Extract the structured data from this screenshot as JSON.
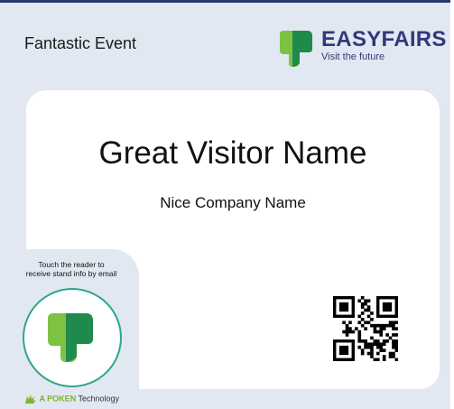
{
  "header": {
    "event_title": "Fantastic Event"
  },
  "logo": {
    "brand_name": "EASYFAIRS",
    "tagline": "Visit the future"
  },
  "card": {
    "visitor_name": "Great Visitor Name",
    "company_name": "Nice Company Name"
  },
  "reader": {
    "instruction_line1": "Touch the reader to",
    "instruction_line2": "receive stand info by email",
    "brand_prefix": "A POKEN",
    "brand_suffix": " Technology"
  },
  "icons": {
    "logo": "easyfairs-logo-icon",
    "reader": "easyfairs-reader-icon",
    "poken": "poken-hand-icon",
    "qr": "qr-code-icon"
  },
  "colors": {
    "brand_navy": "#2f3a7b",
    "green_dark": "#1f8a4c",
    "green_light": "#7ec242",
    "teal": "#2ea58f",
    "badge_bg": "#e1e8f1"
  }
}
